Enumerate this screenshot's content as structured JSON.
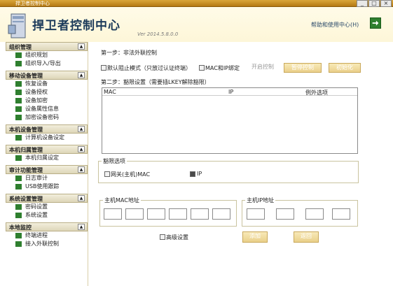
{
  "titlebar": {
    "text": "捍卫者控制中心",
    "min_label": "_",
    "max_label": "□",
    "close_label": "×"
  },
  "header": {
    "title": "捍卫者控制中心",
    "version": "Ver 2014.5.8.0.0",
    "help_label": "帮助和使用中心(H)"
  },
  "sidebar": [
    {
      "title": "组织管理",
      "items": [
        "组织规划",
        "组织导入/导出"
      ]
    },
    {
      "title": "移动设备管理",
      "items": [
        "恢复设备",
        "设备授权",
        "设备加密",
        "设备属性信息",
        "加密设备密码"
      ]
    },
    {
      "title": "本机设备管理",
      "items": [
        "计算机设备设定"
      ]
    },
    {
      "title": "本机归属管理",
      "items": [
        "本机归属设定"
      ]
    },
    {
      "title": "审计功能管理",
      "items": [
        "日志审计",
        "USB使用跟踪"
      ]
    },
    {
      "title": "系统设置管理",
      "items": [
        "密码设置",
        "系统设置"
      ]
    },
    {
      "title": "本地监控",
      "items": [
        "终端进程",
        "接入外联控制"
      ]
    }
  ],
  "main": {
    "step1": "第一步：非法外联控制",
    "default_block": "默认阻止模式（只放过认证终端）",
    "mac_ip_bind": "MAC和IP绑定",
    "btn_start": "开启控制",
    "btn_pause": "暂停控制",
    "btn_init": "初始化",
    "step2": "第二步：豁限设置（需要插LKEY解除豁限）",
    "table": {
      "columns": [
        "MAC",
        "IP",
        "例外选项"
      ]
    },
    "exempt_options": {
      "legend": "豁限选项",
      "gateway_mac": "网关(主机)MAC",
      "ip": "IP"
    },
    "host_mac": {
      "legend": "主机MAC地址"
    },
    "host_ip": {
      "legend": "主机IP地址"
    },
    "advanced": "高级设置",
    "btn_add": "添加",
    "btn_back": "返回"
  }
}
